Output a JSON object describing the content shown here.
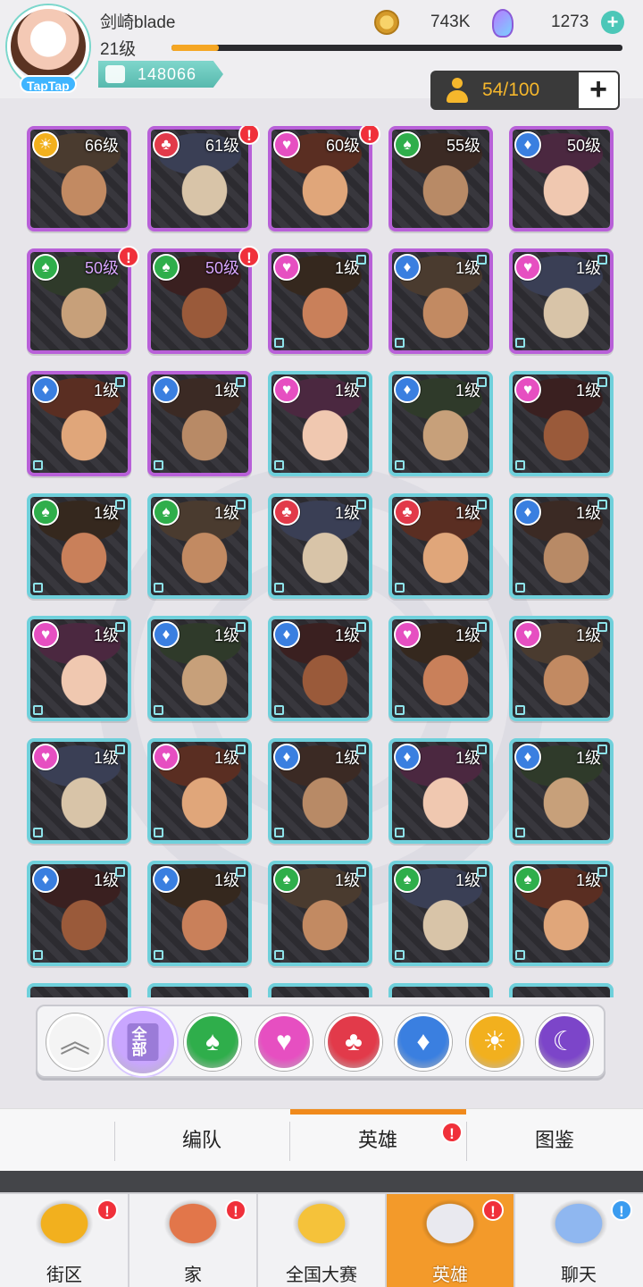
{
  "player": {
    "name": "剑崎blade",
    "level": "21级",
    "xp_progress": 0.105,
    "power": "148066",
    "avatar_tag": "TapTap"
  },
  "currency": {
    "gold": "743K",
    "gems": "1273",
    "add": "+"
  },
  "capacity": {
    "count": "54/100",
    "add": "+"
  },
  "factions": {
    "sun": "#f2b01e",
    "club": "#e23a4a",
    "heart": "#e64fc1",
    "spade": "#2fae4b",
    "diamond": "#3a7fe0",
    "moon": "#7c45c9"
  },
  "heroes": [
    {
      "level": "66级",
      "faction": "sun",
      "rarity": "purple",
      "alert": false
    },
    {
      "level": "61级",
      "faction": "club",
      "rarity": "purple",
      "alert": true
    },
    {
      "level": "60级",
      "faction": "heart",
      "rarity": "purple",
      "alert": true
    },
    {
      "level": "55级",
      "faction": "spade",
      "rarity": "purple",
      "alert": false
    },
    {
      "level": "50级",
      "faction": "diamond",
      "rarity": "purple",
      "alert": false
    },
    {
      "level": "50级",
      "faction": "spade",
      "rarity": "purple",
      "alert": true
    },
    {
      "level": "50级",
      "faction": "spade",
      "rarity": "purple",
      "alert": true
    },
    {
      "level": "1级",
      "faction": "heart",
      "rarity": "purple",
      "alert": false
    },
    {
      "level": "1级",
      "faction": "diamond",
      "rarity": "purple",
      "alert": false
    },
    {
      "level": "1级",
      "faction": "heart",
      "rarity": "purple",
      "alert": false
    },
    {
      "level": "1级",
      "faction": "diamond",
      "rarity": "purple",
      "alert": false
    },
    {
      "level": "1级",
      "faction": "diamond",
      "rarity": "purple",
      "alert": false
    },
    {
      "level": "1级",
      "faction": "heart",
      "rarity": "blue",
      "alert": false
    },
    {
      "level": "1级",
      "faction": "diamond",
      "rarity": "blue",
      "alert": false
    },
    {
      "level": "1级",
      "faction": "heart",
      "rarity": "blue",
      "alert": false
    },
    {
      "level": "1级",
      "faction": "spade",
      "rarity": "blue",
      "alert": false
    },
    {
      "level": "1级",
      "faction": "spade",
      "rarity": "blue",
      "alert": false
    },
    {
      "level": "1级",
      "faction": "club",
      "rarity": "blue",
      "alert": false
    },
    {
      "level": "1级",
      "faction": "club",
      "rarity": "blue",
      "alert": false
    },
    {
      "level": "1级",
      "faction": "diamond",
      "rarity": "blue",
      "alert": false
    },
    {
      "level": "1级",
      "faction": "heart",
      "rarity": "blue",
      "alert": false
    },
    {
      "level": "1级",
      "faction": "diamond",
      "rarity": "blue",
      "alert": false
    },
    {
      "level": "1级",
      "faction": "diamond",
      "rarity": "blue",
      "alert": false
    },
    {
      "level": "1级",
      "faction": "heart",
      "rarity": "blue",
      "alert": false
    },
    {
      "level": "1级",
      "faction": "heart",
      "rarity": "blue",
      "alert": false
    },
    {
      "level": "1级",
      "faction": "heart",
      "rarity": "blue",
      "alert": false
    },
    {
      "level": "1级",
      "faction": "heart",
      "rarity": "blue",
      "alert": false
    },
    {
      "level": "1级",
      "faction": "diamond",
      "rarity": "blue",
      "alert": false
    },
    {
      "level": "1级",
      "faction": "diamond",
      "rarity": "blue",
      "alert": false
    },
    {
      "level": "1级",
      "faction": "diamond",
      "rarity": "blue",
      "alert": false
    },
    {
      "level": "1级",
      "faction": "diamond",
      "rarity": "blue",
      "alert": false
    },
    {
      "level": "1级",
      "faction": "diamond",
      "rarity": "blue",
      "alert": false
    },
    {
      "level": "1级",
      "faction": "spade",
      "rarity": "blue",
      "alert": false
    },
    {
      "level": "1级",
      "faction": "spade",
      "rarity": "blue",
      "alert": false
    },
    {
      "level": "1级",
      "faction": "spade",
      "rarity": "blue",
      "alert": false
    }
  ],
  "filters": [
    {
      "name": "collapse",
      "glyph": "︽",
      "color": "#f4f4f4"
    },
    {
      "name": "all",
      "glyph": "全部",
      "color": "#c9a6ff"
    },
    {
      "name": "spade",
      "glyph": "♠",
      "color": "#2fae4b"
    },
    {
      "name": "heart",
      "glyph": "♥",
      "color": "#e64fc1"
    },
    {
      "name": "club",
      "glyph": "♣",
      "color": "#e23a4a"
    },
    {
      "name": "diamond",
      "glyph": "♦",
      "color": "#3a7fe0"
    },
    {
      "name": "sun",
      "glyph": "☀",
      "color": "#f2b01e"
    },
    {
      "name": "moon",
      "glyph": "☾",
      "color": "#7c45c9"
    }
  ],
  "subtabs": [
    {
      "label": "编队",
      "active": false,
      "alert": false
    },
    {
      "label": "英雄",
      "active": true,
      "alert": true
    },
    {
      "label": "图鉴",
      "active": false,
      "alert": false
    }
  ],
  "nav": [
    {
      "label": "街区",
      "icon": "signpost-icon",
      "active": false,
      "alert": true,
      "alert_color": "#f0303a",
      "alert_glyph": "!"
    },
    {
      "label": "家",
      "icon": "house-icon",
      "active": false,
      "alert": true,
      "alert_color": "#f0303a",
      "alert_glyph": "!"
    },
    {
      "label": "全国大赛",
      "icon": "trophy-icon",
      "active": false,
      "alert": false
    },
    {
      "label": "英雄",
      "icon": "hero-cards-icon",
      "active": true,
      "alert": true,
      "alert_color": "#f0303a",
      "alert_glyph": "!"
    },
    {
      "label": "聊天",
      "icon": "chat-bubble-icon",
      "active": false,
      "alert": true,
      "alert_color": "#3a9cf0",
      "alert_glyph": "!"
    }
  ]
}
